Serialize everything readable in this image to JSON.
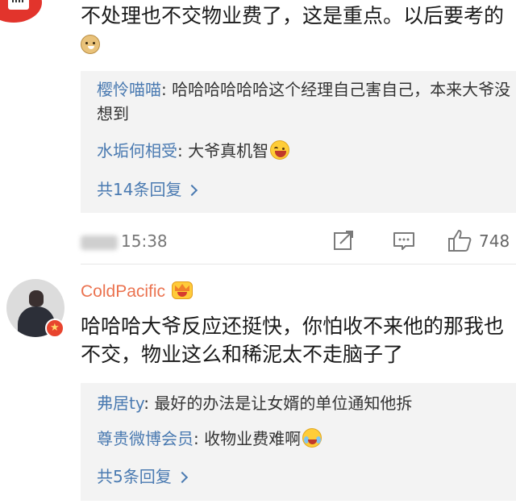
{
  "post1": {
    "text": "不处理也不交物业费了，这是重点。以后要考的",
    "emoji": "doge-emoji",
    "replies": [
      {
        "author": "樱怜喵喵",
        "text": "哈哈哈哈哈哈这个经理自己害自己，本来大爷没想到"
      },
      {
        "author": "水垢何相受",
        "text": "大爷真机智",
        "emoji": "laugh-emoji"
      }
    ],
    "more_replies": "共14条回复",
    "time": "15:38",
    "likes": "748"
  },
  "post2": {
    "username": "ColdPacific",
    "text": "哈哈哈大爷反应还挺快，你怕收不来他的那我也不交，物业这么和稀泥太不走脑子了",
    "replies": [
      {
        "author": "弗居ty",
        "text": "最好的办法是让女婿的单位通知他拆"
      },
      {
        "author": "尊贵微博会员",
        "text": "收物业费难啊",
        "emoji": "cry-laugh-emoji"
      }
    ],
    "more_replies": "共5条回复"
  },
  "colors": {
    "author_orange": "#eb7350",
    "link_blue": "#4a7ab1",
    "reply_bg": "#f3f3f3"
  },
  "icons": [
    "share-icon",
    "comment-icon",
    "like-icon",
    "vip-crown-icon",
    "vip-badge-icon"
  ]
}
